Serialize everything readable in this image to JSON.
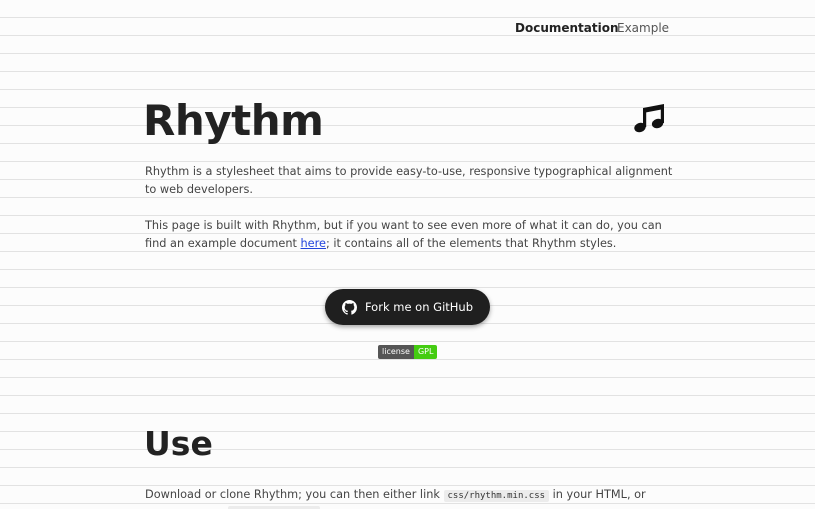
{
  "nav": {
    "documentation": "Documentation",
    "example": "Example"
  },
  "hero": {
    "title": "Rhythm",
    "icon": "music-note-icon"
  },
  "intro": {
    "paragraph1": "Rhythm is a stylesheet that aims to provide easy-to-use, responsive typographical alignment to web developers.",
    "paragraph2_before": "This page is built with Rhythm, but if you want to see even more of what it can do, you can find an example document ",
    "paragraph2_link": "here",
    "paragraph2_after": "; it contains all of the elements that Rhythm styles."
  },
  "fork_button": {
    "label": "Fork me on GitHub",
    "icon": "github-icon"
  },
  "badge": {
    "key": "license",
    "value": "GPL",
    "key_color": "#555555",
    "value_color": "#44cc11"
  },
  "use_section": {
    "title": "Use",
    "text_before": "Download or clone Rhythm; you can then either link ",
    "code": "css/rhythm.min.css",
    "text_after": " in your HTML, or"
  }
}
